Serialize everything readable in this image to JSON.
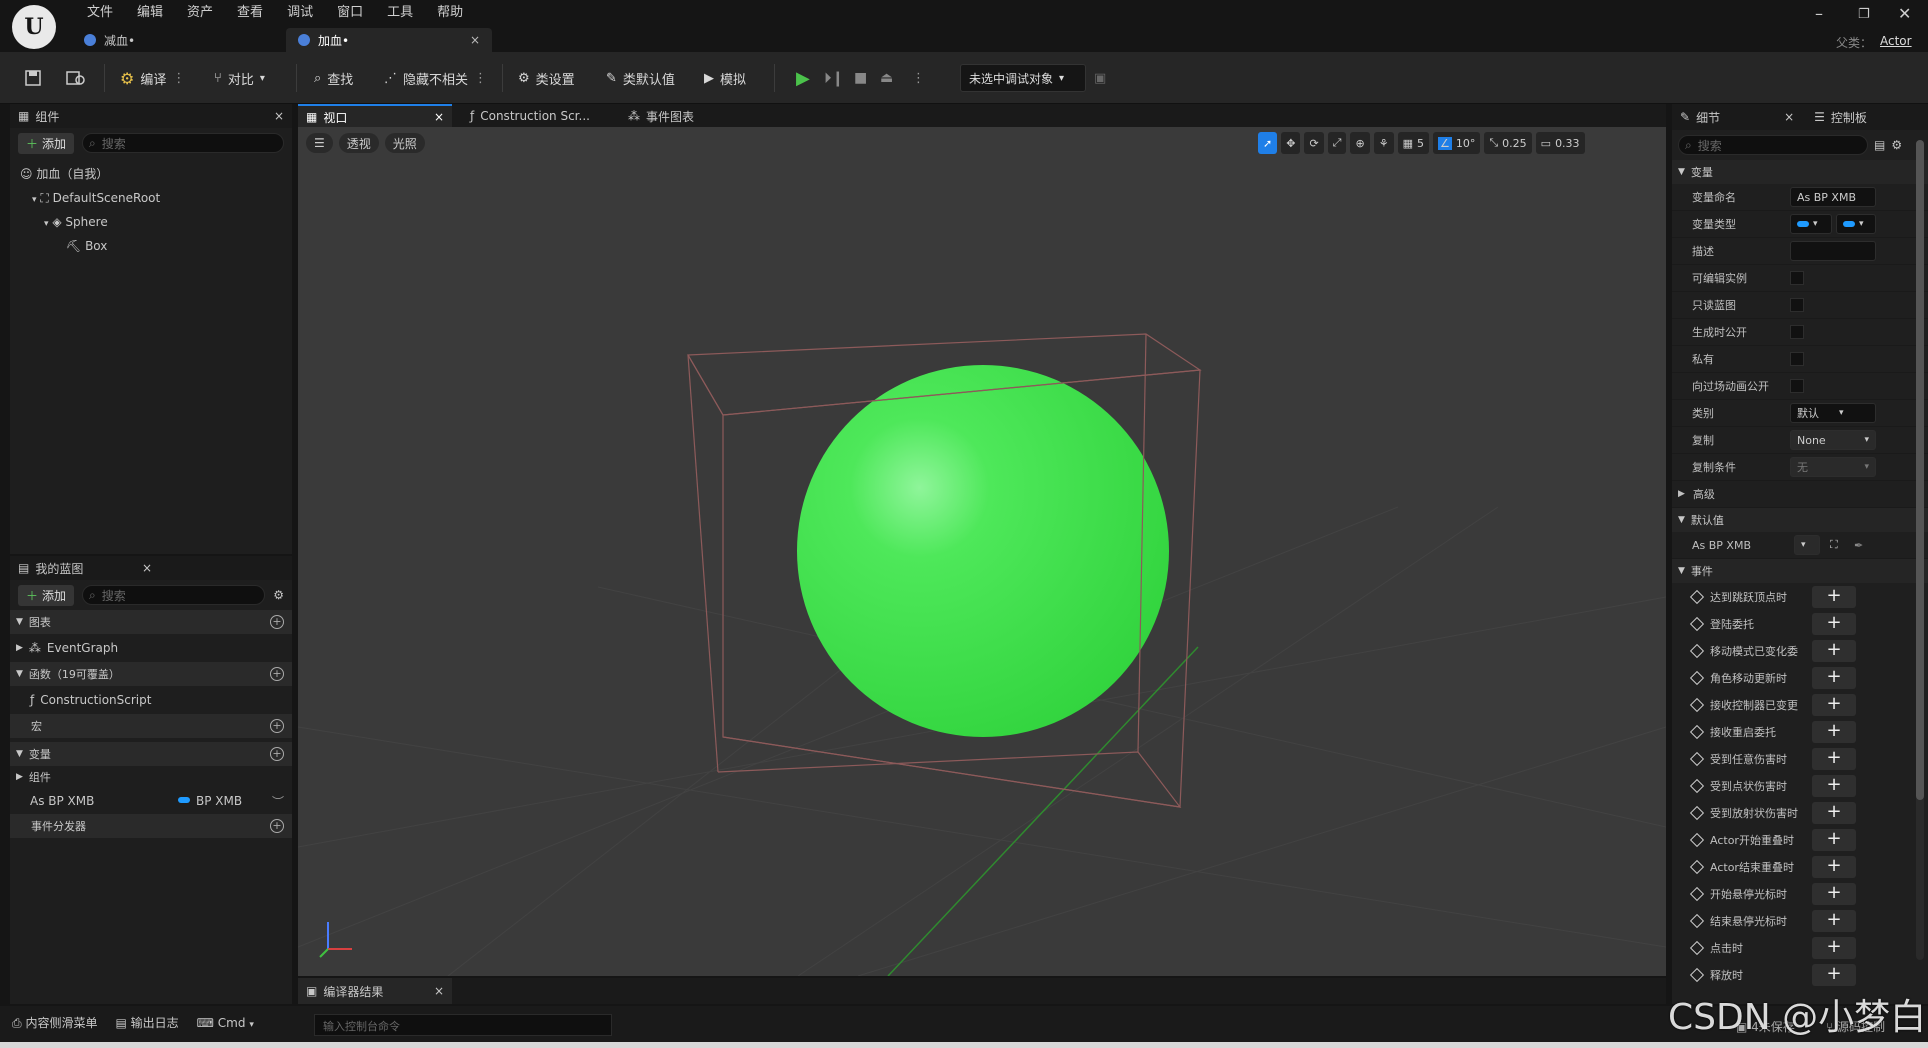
{
  "app": {
    "menu": [
      "文件",
      "编辑",
      "资产",
      "查看",
      "调试",
      "窗口",
      "工具",
      "帮助"
    ],
    "tabs": [
      {
        "label": "减血•"
      },
      {
        "label": "加血•"
      }
    ],
    "parent_class_label": "父类：",
    "parent_class_value": "Actor"
  },
  "toolbar": {
    "compile": "编译",
    "diff": "对比",
    "find": "查找",
    "hide_unrelated": "隐藏不相关",
    "class_settings": "类设置",
    "class_defaults": "类默认值",
    "simulate": "模拟",
    "debug_target": "未选中调试对象"
  },
  "components": {
    "title": "组件",
    "add": "添加",
    "search_placeholder": "搜索",
    "tree": [
      "加血（自我）",
      "DefaultSceneRoot",
      "Sphere",
      "Box"
    ]
  },
  "my_blueprint": {
    "title": "我的蓝图",
    "add": "添加",
    "search_placeholder": "搜索",
    "graphs_label": "图表",
    "event_graph": "EventGraph",
    "functions_label": "函数（19可覆盖）",
    "construction_script": "ConstructionScript",
    "macros_label": "宏",
    "variables_label": "变量",
    "components_label": "组件",
    "var_name": "As BP XMB",
    "var_type": "BP XMB",
    "event_dispatchers_label": "事件分发器"
  },
  "center_tabs": {
    "viewport": "视口",
    "construction": "Construction Scr...",
    "event_graph": "事件图表"
  },
  "viewport": {
    "perspective": "透视",
    "lit": "光照",
    "grid_size": "5",
    "rot_snap": "10°",
    "scale_snap": "0.25",
    "camera_speed": "0.33"
  },
  "compiler_results": "编译器结果",
  "details": {
    "title": "细节",
    "control_panel": "控制板",
    "search_placeholder": "搜索",
    "variable_section": "变量",
    "var_name_label": "变量命名",
    "var_name_value": "As BP XMB",
    "var_type_label": "变量类型",
    "description_label": "描述",
    "instance_editable": "可编辑实例",
    "read_only": "只读蓝图",
    "expose_on_spawn": "生成时公开",
    "private": "私有",
    "expose_cinematics": "向过场动画公开",
    "category_label": "类别",
    "category_value": "默认",
    "replication_label": "复制",
    "replication_value": "None",
    "rep_condition_label": "复制条件",
    "rep_condition_value": "无",
    "advanced": "高级",
    "default_value_section": "默认值",
    "default_var": "As BP XMB",
    "events_section": "事件",
    "events": [
      "达到跳跃顶点时",
      "登陆委托",
      "移动模式已变化委",
      "角色移动更新时",
      "接收控制器已变更",
      "接收重启委托",
      "受到任意伤害时",
      "受到点状伤害时",
      "受到放射状伤害时",
      "Actor开始重叠时",
      "Actor结束重叠时",
      "开始悬停光标时",
      "结束悬停光标时",
      "点击时",
      "释放时"
    ]
  },
  "statusbar": {
    "content_drawer": "内容侧滑菜单",
    "output_log": "输出日志",
    "cmd": "Cmd",
    "console_placeholder": "输入控制台命令",
    "source_control": "源码控制",
    "save_all": "4未保存"
  },
  "watermark": "CSDN @小梦白",
  "colors": {
    "accent": "#1f7fe8",
    "sphere": "#3fe24a",
    "play": "#4bc24b"
  }
}
